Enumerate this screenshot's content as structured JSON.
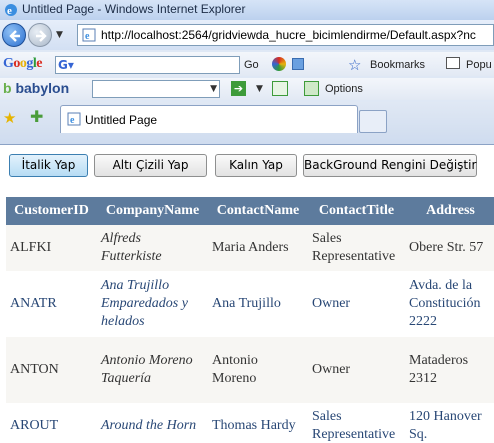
{
  "window": {
    "title": "Untitled Page - Windows Internet Explorer"
  },
  "address_bar": {
    "url": "http://localhost:2564/gridviewda_hucre_bicimlendirme/Default.aspx?nc"
  },
  "google_toolbar": {
    "logo": "Google",
    "go_label": "Go",
    "bookmarks_label": "Bookmarks",
    "popup_label": "Popu"
  },
  "babylon_toolbar": {
    "logo": "babylon",
    "options_label": "Options"
  },
  "tab": {
    "label": "Untitled Page"
  },
  "buttons": {
    "italic": "İtalik Yap",
    "underline": "Altı Çizili Yap",
    "bold": "Kalın Yap",
    "background": "BackGround Rengini Değiştir"
  },
  "grid": {
    "headers": [
      "CustomerID",
      "CompanyName",
      "ContactName",
      "ContactTitle",
      "Address"
    ],
    "rows": [
      {
        "id": "ALFKI",
        "company": "Alfreds Futterkiste",
        "contact": "Maria Anders",
        "title": "Sales Representative",
        "address": "Obere Str. 57"
      },
      {
        "id": "ANATR",
        "company": "Ana Trujillo Emparedados y helados",
        "contact": "Ana Trujillo",
        "title": "Owner",
        "address": "Avda. de la Constitución 2222"
      },
      {
        "id": "ANTON",
        "company": "Antonio Moreno Taquería",
        "contact": "Antonio Moreno",
        "title": "Owner",
        "address": "Mataderos 2312"
      },
      {
        "id": "AROUT",
        "company": "Around the Horn",
        "contact": "Thomas Hardy",
        "title": "Sales Representative",
        "address": "120 Hanover Sq."
      }
    ]
  },
  "colors": {
    "grid_header": "#5d7b9d",
    "row_odd": "#f7f6f3",
    "row_even_text": "#284775"
  }
}
